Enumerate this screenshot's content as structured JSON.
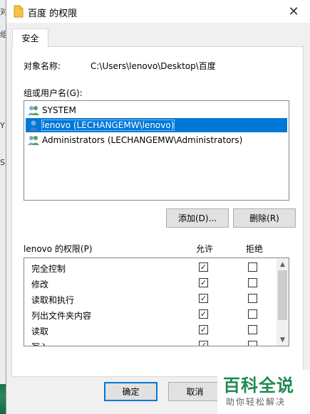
{
  "background": {
    "left_fragments": [
      "对",
      "组",
      "Y",
      "S"
    ]
  },
  "window": {
    "title": "百度 的权限",
    "close_glyph": "✕",
    "tab_label": "安全"
  },
  "object": {
    "label": "对象名称:",
    "value": "C:\\Users\\lenovo\\Desktop\\百度"
  },
  "groups": {
    "label": "组或用户名(G):",
    "users": [
      {
        "name": "SYSTEM",
        "icon": "users-group-icon",
        "selected": false
      },
      {
        "name": "lenovo (LECHANGEMW\\lenovo)",
        "icon": "user-icon",
        "selected": true
      },
      {
        "name": "Administrators (LECHANGEMW\\Administrators)",
        "icon": "users-group-icon",
        "selected": false
      }
    ],
    "add_label": "添加(D)...",
    "remove_label": "删除(R)"
  },
  "permissions": {
    "label": "lenovo 的权限(P)",
    "allow_header": "允许",
    "deny_header": "拒绝",
    "rows": [
      {
        "name": "完全控制",
        "allow": true,
        "deny": false
      },
      {
        "name": "修改",
        "allow": true,
        "deny": false
      },
      {
        "name": "读取和执行",
        "allow": true,
        "deny": false
      },
      {
        "name": "列出文件夹内容",
        "allow": true,
        "deny": false
      },
      {
        "name": "读取",
        "allow": true,
        "deny": false
      },
      {
        "name": "写入",
        "allow": true,
        "deny": false
      }
    ]
  },
  "footer": {
    "ok_label": "确定",
    "cancel_label": "取消"
  },
  "watermark": {
    "title": "百科全说",
    "subtitle": "助你轻松解决"
  },
  "colors": {
    "selection": "#0078d7",
    "watermark_green": "#1f8a50"
  }
}
